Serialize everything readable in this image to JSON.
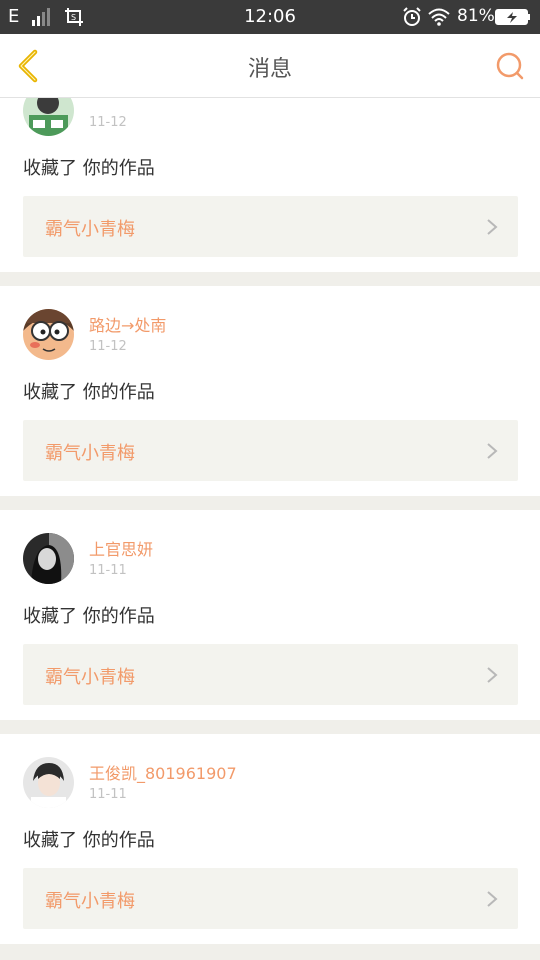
{
  "status_bar": {
    "carrier": "E",
    "time": "12:06",
    "battery_percent": "81%"
  },
  "header": {
    "title": "消息"
  },
  "colors": {
    "accent": "#f29a6a",
    "back_arrow": "#e8b400",
    "status_bar_bg": "#3a3a3a",
    "link_bg": "#f3f3ee"
  },
  "messages": [
    {
      "username": "",
      "date": "11-12",
      "action": "收藏了 你的作品",
      "work_title": "霸气小青梅",
      "avatar_icon": "avatar-icon"
    },
    {
      "username": "路边→处南",
      "date": "11-12",
      "action": "收藏了 你的作品",
      "work_title": "霸气小青梅",
      "avatar_icon": "avatar-icon"
    },
    {
      "username": "上官思妍",
      "date": "11-11",
      "action": "收藏了 你的作品",
      "work_title": "霸气小青梅",
      "avatar_icon": "avatar-icon"
    },
    {
      "username": "王俊凯_801961907",
      "date": "11-11",
      "action": "收藏了 你的作品",
      "work_title": "霸气小青梅",
      "avatar_icon": "avatar-icon"
    }
  ]
}
